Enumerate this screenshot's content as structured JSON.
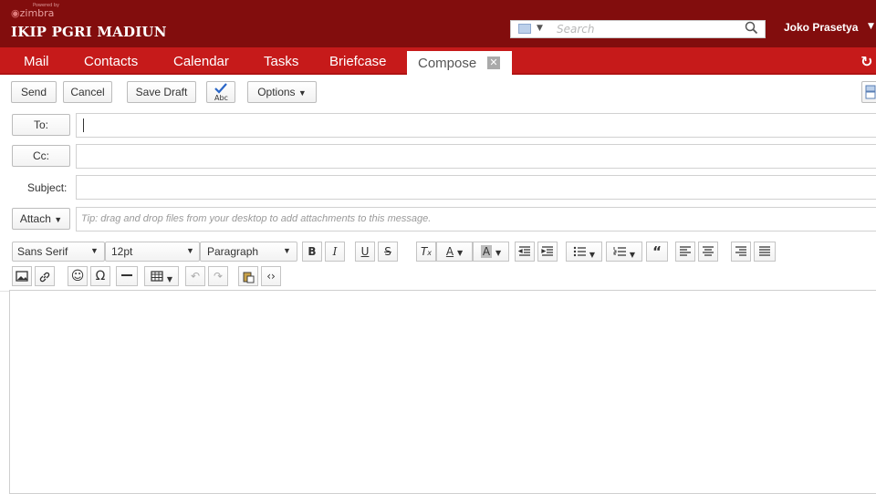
{
  "header": {
    "powered_by": "Powered by",
    "brand": "zimbra",
    "org_title": "IKIP PGRI MADIUN",
    "search_placeholder": "Search",
    "user_name": "Joko Prasetya"
  },
  "tabs": [
    {
      "label": "Mail"
    },
    {
      "label": "Contacts"
    },
    {
      "label": "Calendar"
    },
    {
      "label": "Tasks"
    },
    {
      "label": "Briefcase"
    }
  ],
  "active_tab": {
    "label": "Compose"
  },
  "toolbar": {
    "send": "Send",
    "cancel": "Cancel",
    "save_draft": "Save Draft",
    "spell_check": "Abc",
    "options": "Options"
  },
  "compose": {
    "to_label": "To:",
    "to_value": "",
    "cc_label": "Cc:",
    "cc_value": "",
    "subject_label": "Subject:",
    "subject_value": "",
    "attach_label": "Attach",
    "attach_hint": "Tip: drag and drop files from your desktop to add attachments to this message."
  },
  "editor_toolbar": {
    "font_family": "Sans Serif",
    "font_size": "12pt",
    "paragraph": "Paragraph"
  },
  "colors": {
    "header_bg": "#820d0d",
    "tabbar_bg": "#c61a1a"
  }
}
